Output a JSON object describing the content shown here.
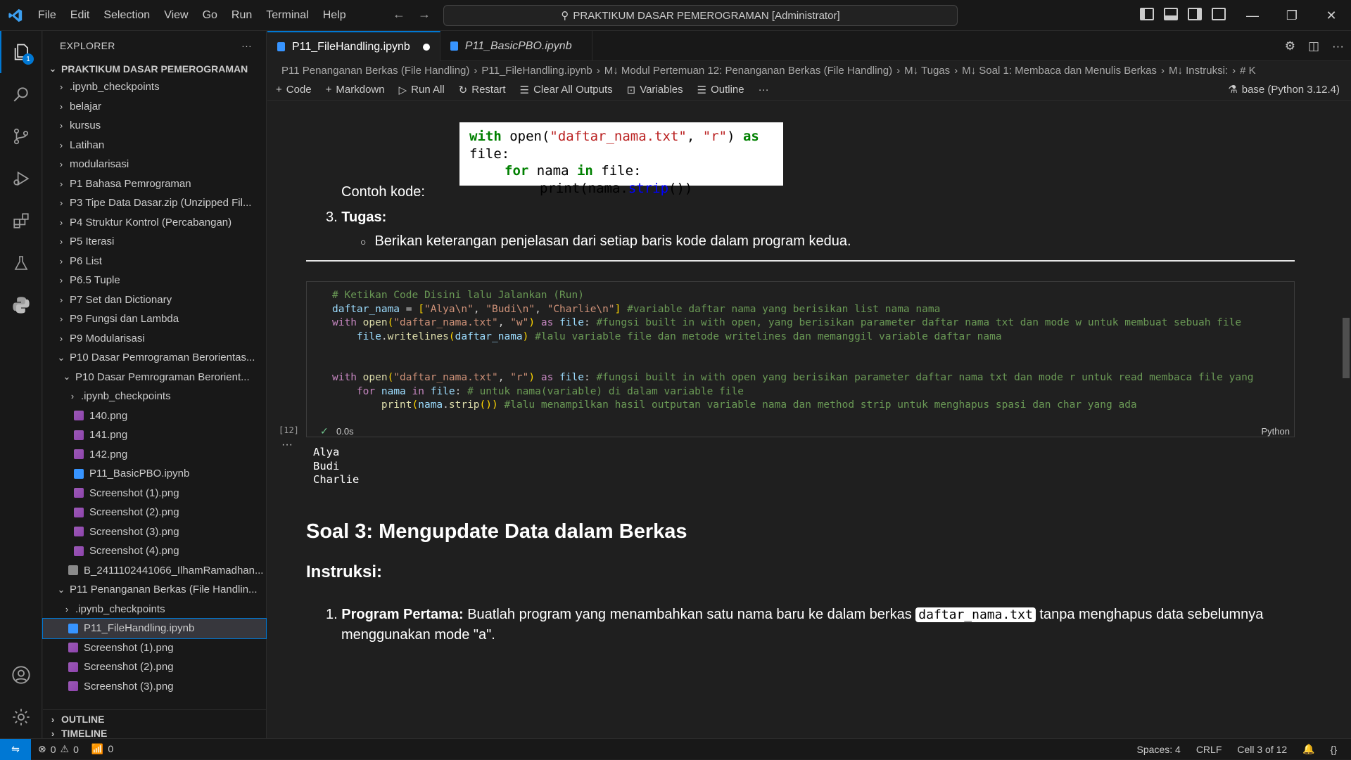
{
  "menu": [
    "File",
    "Edit",
    "Selection",
    "View",
    "Go",
    "Run",
    "Terminal",
    "Help"
  ],
  "search_text": "PRAKTIKUM DASAR PEMEROGRAMAN [Administrator]",
  "activity_badge": "1",
  "explorer": {
    "title": "EXPLORER",
    "more": "···",
    "root": "PRAKTIKUM DASAR PEMEROGRAMAN",
    "items": [
      {
        "label": ".ipynb_checkpoints",
        "type": "folder",
        "depth": 0,
        "open": false
      },
      {
        "label": "belajar",
        "type": "folder",
        "depth": 0,
        "open": false
      },
      {
        "label": "kursus",
        "type": "folder",
        "depth": 0,
        "open": false
      },
      {
        "label": "Latihan",
        "type": "folder",
        "depth": 0,
        "open": false
      },
      {
        "label": "modularisasi",
        "type": "folder",
        "depth": 0,
        "open": false
      },
      {
        "label": "P1 Bahasa Pemrograman",
        "type": "folder",
        "depth": 0,
        "open": false
      },
      {
        "label": "P3 Tipe Data Dasar.zip (Unzipped Fil...",
        "type": "folder",
        "depth": 0,
        "open": false
      },
      {
        "label": "P4 Struktur Kontrol (Percabangan)",
        "type": "folder",
        "depth": 0,
        "open": false
      },
      {
        "label": "P5 Iterasi",
        "type": "folder",
        "depth": 0,
        "open": false
      },
      {
        "label": "P6 List",
        "type": "folder",
        "depth": 0,
        "open": false
      },
      {
        "label": "P6.5 Tuple",
        "type": "folder",
        "depth": 0,
        "open": false
      },
      {
        "label": "P7 Set dan Dictionary",
        "type": "folder",
        "depth": 0,
        "open": false
      },
      {
        "label": "P9 Fungsi dan Lambda",
        "type": "folder",
        "depth": 0,
        "open": false
      },
      {
        "label": "P9 Modularisasi",
        "type": "folder",
        "depth": 0,
        "open": false
      },
      {
        "label": "P10 Dasar Pemrograman Berorientas...",
        "type": "folder",
        "depth": 0,
        "open": true
      },
      {
        "label": "P10 Dasar Pemrograman Berorient...",
        "type": "folder",
        "depth": 1,
        "open": true
      },
      {
        "label": ".ipynb_checkpoints",
        "type": "folder",
        "depth": 2,
        "open": false
      },
      {
        "label": "140.png",
        "type": "img",
        "depth": 2
      },
      {
        "label": "141.png",
        "type": "img",
        "depth": 2
      },
      {
        "label": "142.png",
        "type": "img",
        "depth": 2
      },
      {
        "label": "P11_BasicPBO.ipynb",
        "type": "nb",
        "depth": 2
      },
      {
        "label": "Screenshot (1).png",
        "type": "img",
        "depth": 2
      },
      {
        "label": "Screenshot (2).png",
        "type": "img",
        "depth": 2
      },
      {
        "label": "Screenshot (3).png",
        "type": "img",
        "depth": 2
      },
      {
        "label": "Screenshot (4).png",
        "type": "img",
        "depth": 2
      },
      {
        "label": "B_2411102441066_IlhamRamadhan...",
        "type": "zip",
        "depth": 1
      },
      {
        "label": "P11 Penanganan Berkas (File Handlin...",
        "type": "folder",
        "depth": 0,
        "open": true
      },
      {
        "label": ".ipynb_checkpoints",
        "type": "folder",
        "depth": 1,
        "open": false
      },
      {
        "label": "P11_FileHandling.ipynb",
        "type": "nb",
        "depth": 1,
        "selected": true
      },
      {
        "label": "Screenshot (1).png",
        "type": "img",
        "depth": 1
      },
      {
        "label": "Screenshot (2).png",
        "type": "img",
        "depth": 1
      },
      {
        "label": "Screenshot (3).png",
        "type": "img",
        "depth": 1
      }
    ],
    "outline": "OUTLINE",
    "timeline": "TIMELINE"
  },
  "tabs": [
    {
      "label": "P11_FileHandling.ipynb",
      "active": true,
      "dirty": true
    },
    {
      "label": "P11_BasicPBO.ipynb",
      "active": false
    }
  ],
  "breadcrumb": [
    "P11 Penanganan Berkas (File Handling)",
    "P11_FileHandling.ipynb",
    "M↓ Modul Pertemuan 12: Penanganan Berkas (File Handling)",
    "M↓ Tugas",
    "M↓ Soal 1: Membaca dan Menulis Berkas",
    "M↓ Instruksi:",
    "# K"
  ],
  "toolbar": {
    "code": "Code",
    "markdown": "Markdown",
    "run_all": "Run All",
    "restart": "Restart",
    "clear": "Clear All Outputs",
    "variables": "Variables",
    "outline": "Outline",
    "more": "···",
    "kernel": "base (Python 3.12.4)"
  },
  "markdown_top": {
    "contoh": "Contoh kode:",
    "tugas_num": "3.",
    "tugas": "Tugas:",
    "bullet": "Berikan keterangan penjelasan dari setiap baris kode dalam program kedua."
  },
  "code_image": {
    "line1": "with open(\"daftar_nama.txt\", \"r\") as file:",
    "line2": "for nama in file:",
    "line3": "print(nama.strip())"
  },
  "cell": {
    "exec_count": "[12]",
    "status": "0.0s",
    "lang": "Python",
    "output_more": "···",
    "output": [
      "Alya",
      "Budi",
      "Charlie"
    ]
  },
  "markdown_bottom": {
    "heading": "Soal 3: Mengupdate Data dalam Berkas",
    "subheading": "Instruksi:",
    "item_num": "1.",
    "item_bold": "Program Pertama:",
    "item_text_a": "Buatlah program yang menambahkan satu nama baru ke dalam berkas",
    "item_code": "daftar_nama.txt",
    "item_text_b": "tanpa menghapus data sebelumnya",
    "item_text_c": "menggunakan mode \"a\"."
  },
  "statusbar": {
    "errors": "0",
    "warnings": "0",
    "ports": "0",
    "spaces": "Spaces: 4",
    "eol": "CRLF",
    "cell": "Cell 3 of 12"
  },
  "colors": {
    "accent": "#0078d4",
    "background": "#1f1f1f",
    "sidebar": "#181818"
  }
}
